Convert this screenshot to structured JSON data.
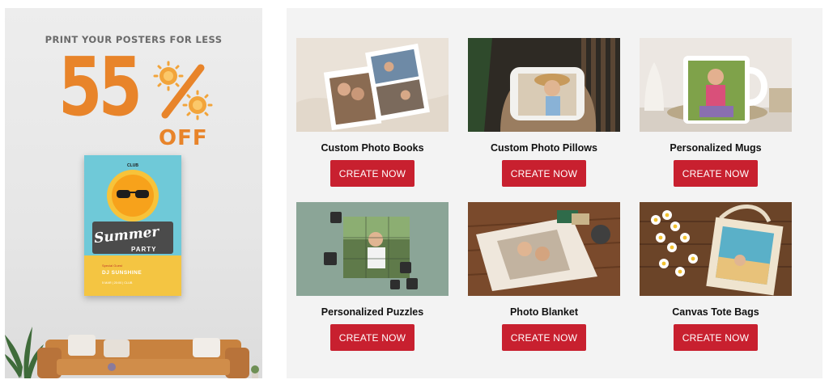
{
  "promo": {
    "tagline": "PRINT YOUR POSTERS FOR LESS",
    "discount_number": "55",
    "discount_suffix": "OFF",
    "accent_color": "#e8842a",
    "poster": {
      "club": "CLUB",
      "title": "Summer",
      "subtitle": "PARTY",
      "guest_label": "Special Guest",
      "dj": "DJ SUNSHINE",
      "dates": "5 MAR  |  20:00  |  CLUB"
    }
  },
  "products": [
    {
      "title": "Custom Photo Books",
      "button": "CREATE NOW"
    },
    {
      "title": "Custom Photo Pillows",
      "button": "CREATE NOW"
    },
    {
      "title": "Personalized Mugs",
      "button": "CREATE NOW"
    },
    {
      "title": "Personalized Puzzles",
      "button": "CREATE NOW"
    },
    {
      "title": "Photo Blanket",
      "button": "CREATE NOW"
    },
    {
      "title": "Canvas Tote Bags",
      "button": "CREATE NOW"
    }
  ],
  "button_color": "#c8202f"
}
